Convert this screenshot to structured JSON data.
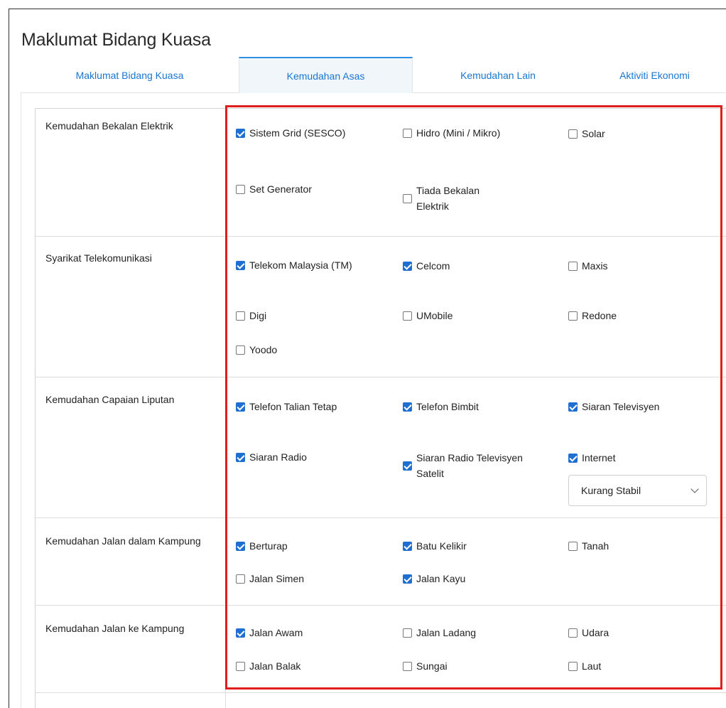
{
  "page_title": "Maklumat Bidang Kuasa",
  "tabs": [
    {
      "label": "Maklumat Bidang Kuasa"
    },
    {
      "label": "Kemudahan Asas"
    },
    {
      "label": "Kemudahan Lain"
    },
    {
      "label": "Aktiviti Ekonomi"
    }
  ],
  "active_tab": "Kemudahan Asas",
  "rows": [
    {
      "label": "Kemudahan Bekalan Elektrik",
      "options": [
        {
          "label": "Sistem Grid (SESCO)",
          "checked": true
        },
        {
          "label": "Hidro (Mini / Mikro)",
          "checked": false
        },
        {
          "label": "Solar",
          "checked": false
        },
        {
          "label": "Set Generator",
          "checked": false
        },
        {
          "label": "Tiada Bekalan Elektrik",
          "checked": false
        }
      ]
    },
    {
      "label": "Syarikat Telekomunikasi",
      "options": [
        {
          "label": "Telekom Malaysia (TM)",
          "checked": true
        },
        {
          "label": "Celcom",
          "checked": true
        },
        {
          "label": "Maxis",
          "checked": false
        },
        {
          "label": "Digi",
          "checked": false
        },
        {
          "label": "UMobile",
          "checked": false
        },
        {
          "label": "Redone",
          "checked": false
        },
        {
          "label": "Yoodo",
          "checked": false
        }
      ]
    },
    {
      "label": "Kemudahan Capaian Liputan",
      "options": [
        {
          "label": "Telefon Talian Tetap",
          "checked": true
        },
        {
          "label": "Telefon Bimbit",
          "checked": true
        },
        {
          "label": "Siaran Televisyen",
          "checked": true
        },
        {
          "label": "Siaran Radio",
          "checked": true
        },
        {
          "label": "Siaran Radio Televisyen Satelit",
          "checked": true
        },
        {
          "label": "Internet",
          "checked": true
        }
      ],
      "internet_quality": "Kurang Stabil"
    },
    {
      "label": "Kemudahan Jalan dalam Kampung",
      "options": [
        {
          "label": "Berturap",
          "checked": true
        },
        {
          "label": "Batu Kelikir",
          "checked": true
        },
        {
          "label": "Tanah",
          "checked": false
        },
        {
          "label": "Jalan Simen",
          "checked": false
        },
        {
          "label": "Jalan Kayu",
          "checked": true
        }
      ]
    },
    {
      "label": "Kemudahan Jalan ke Kampung",
      "options": [
        {
          "label": "Jalan Awam",
          "checked": true
        },
        {
          "label": "Jalan Ladang",
          "checked": false
        },
        {
          "label": "Udara",
          "checked": false
        },
        {
          "label": "Jalan Balak",
          "checked": false
        },
        {
          "label": "Sungai",
          "checked": false
        },
        {
          "label": "Laut",
          "checked": false
        }
      ]
    }
  ],
  "colors": {
    "accent": "#1976d2",
    "checkbox_checked": "#1f6fd1",
    "highlight": "#e01e1e"
  }
}
